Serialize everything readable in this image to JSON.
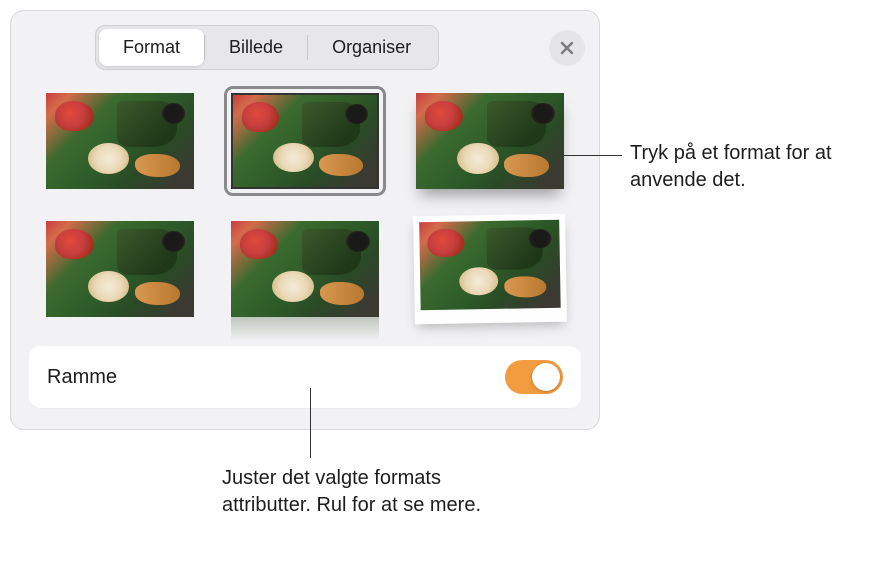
{
  "tabs": {
    "format": "Format",
    "billede": "Billede",
    "organiser": "Organiser"
  },
  "frame": {
    "label": "Ramme",
    "enabled": true
  },
  "styles": [
    {
      "id": "plain",
      "selected": false
    },
    {
      "id": "thin-border",
      "selected": true
    },
    {
      "id": "shadow",
      "selected": false
    },
    {
      "id": "plain2",
      "selected": false
    },
    {
      "id": "reflection",
      "selected": false
    },
    {
      "id": "polaroid",
      "selected": false
    }
  ],
  "callouts": {
    "right": "Tryk på et format for at anvende det.",
    "bottom": "Juster det valgte formats attributter. Rul for at se mere."
  }
}
